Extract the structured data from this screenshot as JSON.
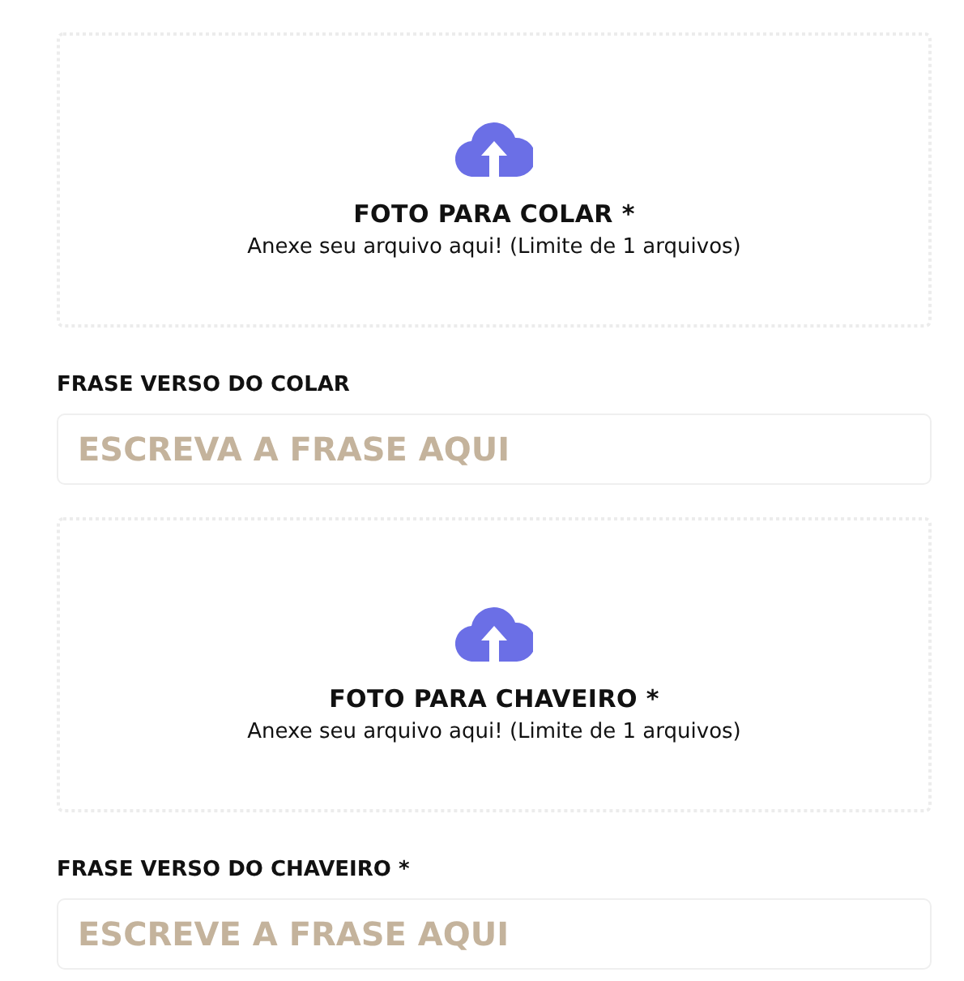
{
  "fields": [
    {
      "kind": "upload",
      "title": "FOTO PARA COLAR *",
      "hint": "Anexe seu arquivo aqui! (Limite de 1 arquivos)"
    },
    {
      "kind": "text",
      "label": "FRASE VERSO DO COLAR",
      "placeholder": "ESCREVA A FRASE AQUI"
    },
    {
      "kind": "upload",
      "title": "FOTO PARA CHAVEIRO *",
      "hint": "Anexe seu arquivo aqui! (Limite de 1 arquivos)"
    },
    {
      "kind": "text",
      "label": "FRASE VERSO DO CHAVEIRO *",
      "placeholder": "ESCREVE A FRASE AQUI"
    }
  ]
}
